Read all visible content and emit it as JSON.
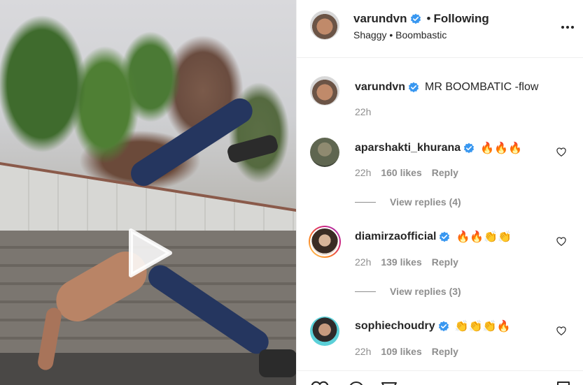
{
  "post": {
    "owner": {
      "username": "varundvn",
      "following_label": "Following",
      "audio_artist": "Shaggy",
      "audio_track": "Boombastic",
      "separator": "•"
    },
    "caption": {
      "username": "varundvn",
      "text": "MR BOOMBATIC -flow",
      "time": "22h"
    },
    "comments": [
      {
        "username": "aparshakti_khurana",
        "text": "🔥🔥🔥",
        "time": "22h",
        "likes": "160 likes",
        "reply": "Reply",
        "view_replies": "View replies (4)"
      },
      {
        "username": "diamirzaofficial",
        "text": "🔥🔥👏👏",
        "time": "22h",
        "likes": "139 likes",
        "reply": "Reply",
        "view_replies": "View replies (3)"
      },
      {
        "username": "sophiechoudry",
        "text": "👏👏👏🔥",
        "time": "22h",
        "likes": "109 likes",
        "reply": "Reply"
      }
    ]
  },
  "colors": {
    "verified": "#3897f0",
    "text": "#262626",
    "secondary": "#8e8e8e"
  },
  "icons": [
    "play-icon",
    "verified-icon",
    "more-options-icon",
    "heart-icon",
    "comment-icon",
    "share-icon",
    "bookmark-icon"
  ]
}
